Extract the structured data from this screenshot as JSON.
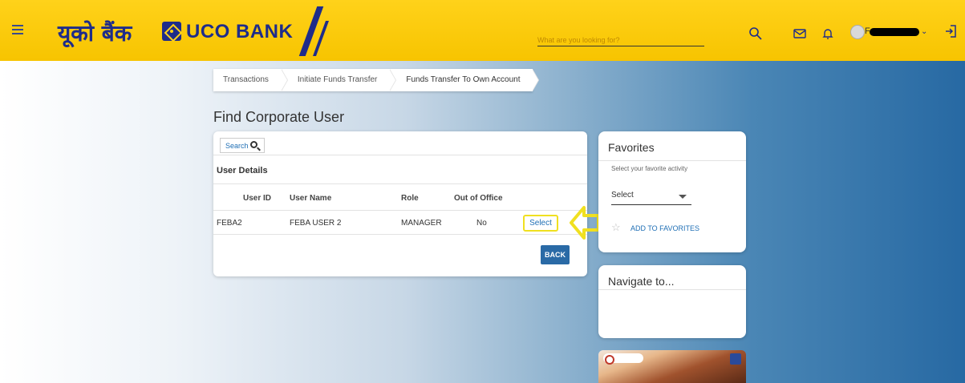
{
  "header": {
    "logo_hindi": "यूको बैंक",
    "logo_text": "UCO BANK",
    "search_placeholder": "What are you looking for?",
    "user_initial": "F"
  },
  "breadcrumb": [
    "Transactions",
    "Initiate Funds Transfer",
    "Funds Transfer To Own Account"
  ],
  "page_title": "Find Corporate User",
  "main": {
    "search_label": "Search",
    "section_title": "User Details",
    "columns": [
      "User ID",
      "User Name",
      "Role",
      "Out of Office"
    ],
    "row": {
      "user_id": "FEBA2",
      "user_name": "FEBA USER 2",
      "role": "MANAGER",
      "out_of_office": "No",
      "action": "Select"
    },
    "back_label": "BACK"
  },
  "favorites": {
    "title": "Favorites",
    "subtitle": "Select your favorite activity",
    "select_value": "Select",
    "add_label": "ADD TO FAVORITES"
  },
  "navigate": {
    "title": "Navigate to..."
  },
  "colors": {
    "header_yellow": "#ffd21a",
    "brand_blue": "#1e2c8a",
    "button_blue": "#2a6aa6",
    "link_blue": "#1f6fb5",
    "highlight": "#f0e020"
  }
}
